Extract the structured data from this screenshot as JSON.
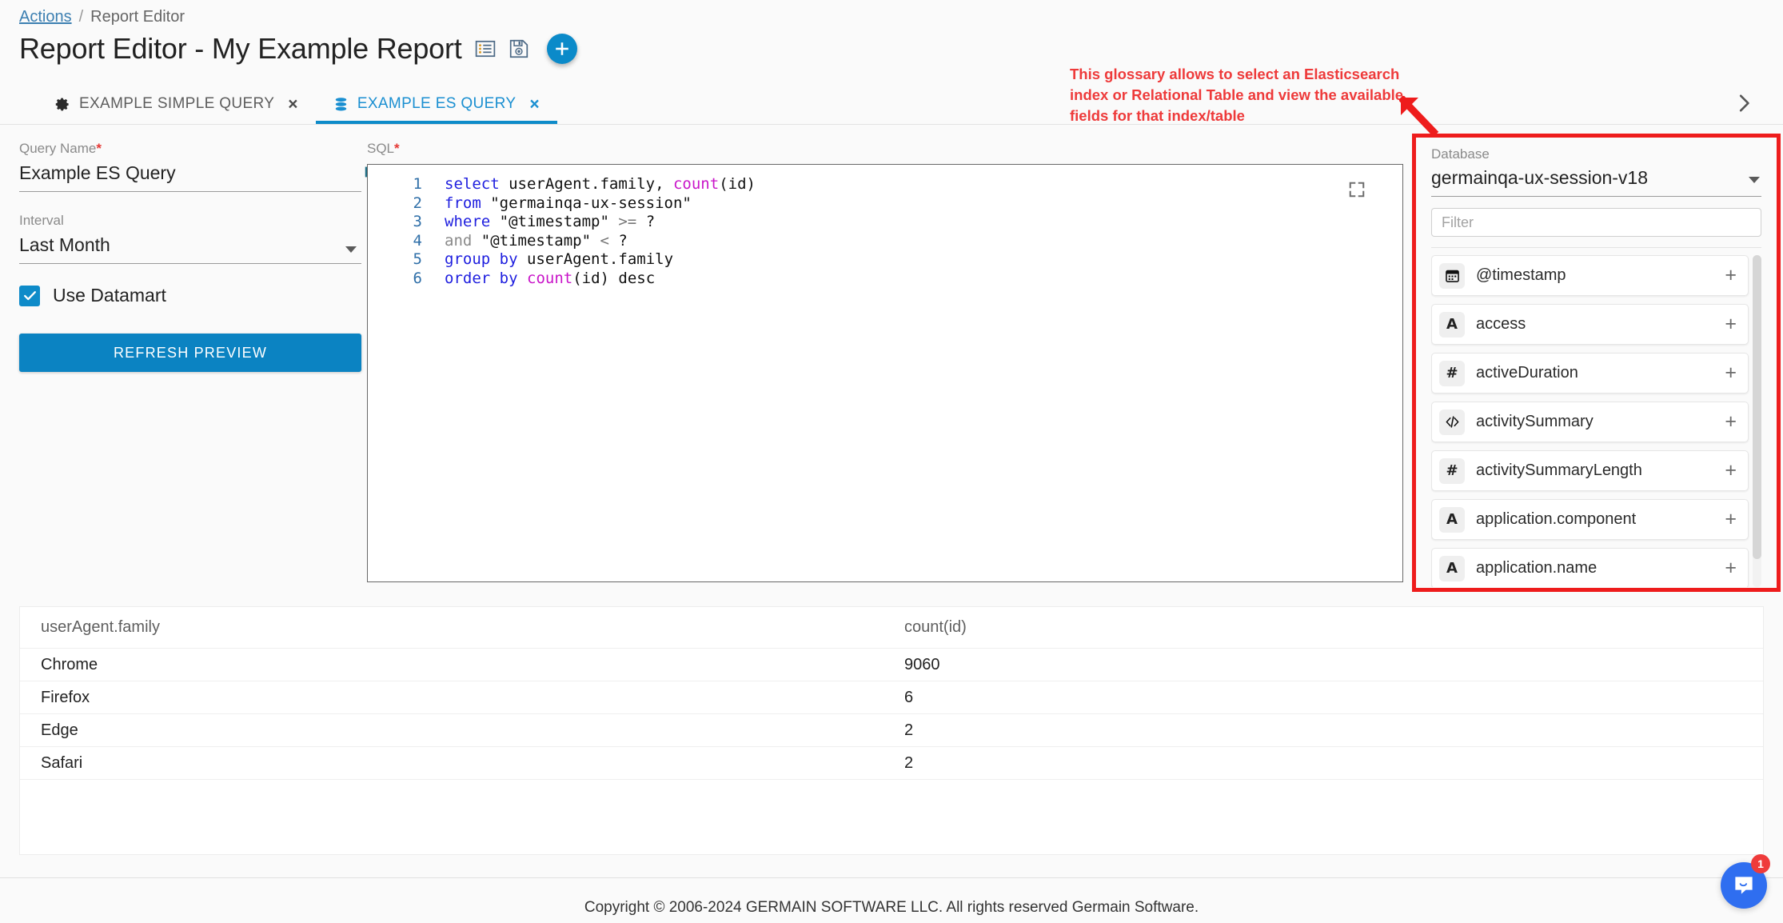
{
  "breadcrumb": {
    "link": "Actions",
    "separator": "/",
    "current": "Report Editor"
  },
  "header": {
    "title": "Report Editor - My Example Report",
    "list_icon": "list-icon",
    "save_icon": "save-icon",
    "add_icon": "plus-icon"
  },
  "tabs": [
    {
      "label": "EXAMPLE SIMPLE QUERY",
      "icon": "gear-icon",
      "close": "×",
      "active": false
    },
    {
      "label": "EXAMPLE ES QUERY",
      "icon": "database-icon",
      "close": "×",
      "active": true
    }
  ],
  "form": {
    "query_name_label": "Query Name",
    "query_name_required": "*",
    "query_name_value": "Example ES Query",
    "interval_label": "Interval",
    "interval_value": "Last Month",
    "interval_options": [
      "Last Month"
    ],
    "datamart_label": "Use Datamart",
    "datamart_checked": true,
    "refresh_label": "REFRESH PREVIEW"
  },
  "sql": {
    "label": "SQL",
    "required": "*",
    "expand_icon": "expand-icon",
    "chart_icon": "bar-chart-icon",
    "lines": [
      {
        "n": "1",
        "tokens": [
          {
            "t": "select",
            "c": "k"
          },
          {
            "t": " userAgent.family, ",
            "c": "pl"
          },
          {
            "t": "count",
            "c": "fn"
          },
          {
            "t": "(id)",
            "c": "pl"
          }
        ]
      },
      {
        "n": "2",
        "tokens": [
          {
            "t": "from",
            "c": "k"
          },
          {
            "t": " \"germainqa-ux-session\"",
            "c": "pl"
          }
        ]
      },
      {
        "n": "3",
        "tokens": [
          {
            "t": "where",
            "c": "k"
          },
          {
            "t": " \"@timestamp\" ",
            "c": "pl"
          },
          {
            "t": ">=",
            "c": "op"
          },
          {
            "t": " ?",
            "c": "pl"
          }
        ]
      },
      {
        "n": "4",
        "tokens": [
          {
            "t": "and",
            "c": "kg"
          },
          {
            "t": " \"@timestamp\" ",
            "c": "pl"
          },
          {
            "t": "<",
            "c": "op"
          },
          {
            "t": " ?",
            "c": "pl"
          }
        ]
      },
      {
        "n": "5",
        "tokens": [
          {
            "t": "group",
            "c": "k"
          },
          {
            "t": " ",
            "c": "pl"
          },
          {
            "t": "by",
            "c": "k"
          },
          {
            "t": " userAgent.family",
            "c": "pl"
          }
        ]
      },
      {
        "n": "6",
        "tokens": [
          {
            "t": "order",
            "c": "k"
          },
          {
            "t": " ",
            "c": "pl"
          },
          {
            "t": "by",
            "c": "k"
          },
          {
            "t": " ",
            "c": "pl"
          },
          {
            "t": "count",
            "c": "fn"
          },
          {
            "t": "(id) desc",
            "c": "pl"
          }
        ]
      }
    ]
  },
  "annotation": {
    "text": "This glossary allows to select an Elasticsearch index or Relational Table and view the available fields for that index/table",
    "color": "#ee3a3a"
  },
  "collapse_chevron": "chevron-right-icon",
  "glossary": {
    "database_label": "Database",
    "database_value": "germainqa-ux-session-v18",
    "filter_placeholder": "Filter",
    "filter_value": "",
    "add_symbol": "+",
    "fields": [
      {
        "name": "@timestamp",
        "type": "date",
        "icon": "calendar-icon"
      },
      {
        "name": "access",
        "type": "string",
        "icon": "letter-a-icon"
      },
      {
        "name": "activeDuration",
        "type": "number",
        "icon": "hash-icon"
      },
      {
        "name": "activitySummary",
        "type": "object",
        "icon": "code-icon"
      },
      {
        "name": "activitySummaryLength",
        "type": "number",
        "icon": "hash-icon"
      },
      {
        "name": "application.component",
        "type": "string",
        "icon": "letter-a-icon"
      },
      {
        "name": "application.name",
        "type": "string",
        "icon": "letter-a-icon"
      }
    ]
  },
  "results": {
    "columns": [
      "userAgent.family",
      "count(id)"
    ],
    "rows": [
      [
        "Chrome",
        "9060"
      ],
      [
        "Firefox",
        "6"
      ],
      [
        "Edge",
        "2"
      ],
      [
        "Safari",
        "2"
      ]
    ]
  },
  "footer": {
    "copyright": "Copyright © 2006-2024 GERMAIN SOFTWARE LLC. All rights reserved Germain Software."
  },
  "chat": {
    "icon": "chat-bubble-icon",
    "badge": "1"
  },
  "colors": {
    "accent": "#0b8ac9",
    "annotation": "#ee1c1c",
    "chat": "#2f6ef0"
  }
}
